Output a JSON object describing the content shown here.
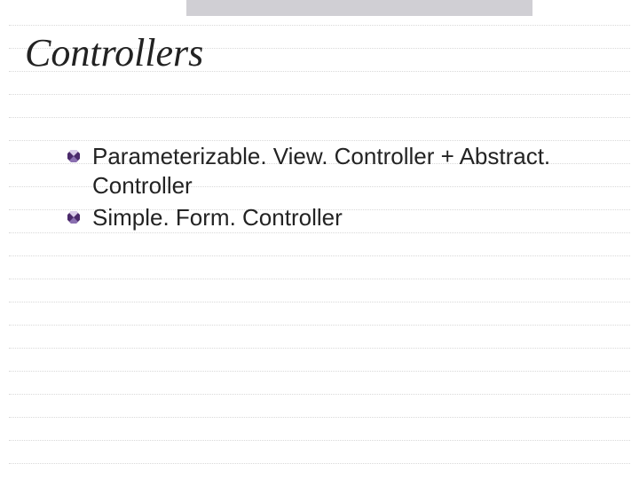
{
  "title": "Controllers",
  "bullets": [
    {
      "text": "Parameterizable. View. Controller + Abstract. Controller"
    },
    {
      "text": "Simple. Form. Controller"
    }
  ],
  "colors": {
    "bullet_dark": "#4b2a6b",
    "bullet_mid": "#8a6fb0",
    "bullet_light": "#d9cce8",
    "topbar": "#d0cfd4",
    "rule": "#d9d9d9"
  }
}
